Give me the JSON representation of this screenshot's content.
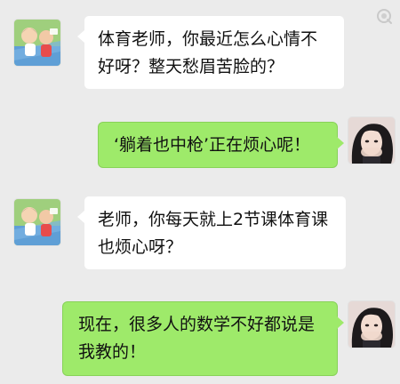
{
  "chat": {
    "messages": [
      {
        "side": "left",
        "text": "体育老师，你最近怎么心情不好呀？整天愁眉苦脸的？"
      },
      {
        "side": "right",
        "text": "‘躺着也中枪’正在烦心呢！"
      },
      {
        "side": "left",
        "text": "老师，你每天就上2节课体育课也烦心呀？"
      },
      {
        "side": "right",
        "text": "现在，很多人的数学不好都说是我教的！"
      }
    ]
  },
  "icons": {
    "teacher_avatar": "cartoon-teacher-avatar",
    "student_avatar": "girl-photo-avatar",
    "watermark": "camera-lens-icon"
  },
  "colors": {
    "background": "#ebebeb",
    "received_bubble": "#ffffff",
    "sent_bubble": "#9eea6a",
    "text": "#111111"
  }
}
